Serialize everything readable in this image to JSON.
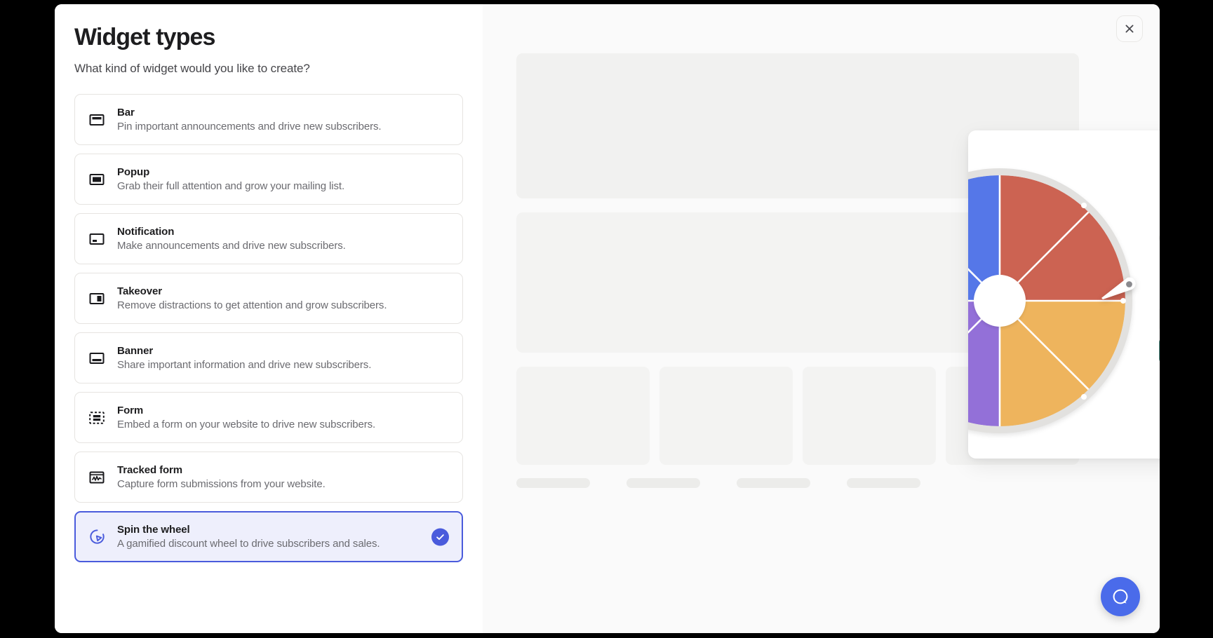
{
  "dialog": {
    "title": "Widget types",
    "subtitle": "What kind of widget would you like to create?",
    "close_label": "×",
    "close_icon": "close-icon"
  },
  "widget_types": [
    {
      "name": "Bar",
      "description": "Pin important announcements and drive new subscribers.",
      "icon": "bar-widget-icon",
      "selected": false
    },
    {
      "name": "Popup",
      "description": "Grab their full attention and grow your mailing list.",
      "icon": "popup-widget-icon",
      "selected": false
    },
    {
      "name": "Notification",
      "description": "Make announcements and drive new subscribers.",
      "icon": "notification-widget-icon",
      "selected": false
    },
    {
      "name": "Takeover",
      "description": "Remove distractions to get attention and grow subscribers.",
      "icon": "takeover-widget-icon",
      "selected": false
    },
    {
      "name": "Banner",
      "description": "Share important information and drive new subscribers.",
      "icon": "banner-widget-icon",
      "selected": false
    },
    {
      "name": "Form",
      "description": "Embed a form on your website to drive new subscribers.",
      "icon": "form-widget-icon",
      "selected": false
    },
    {
      "name": "Tracked form",
      "description": "Capture form submissions from your website.",
      "icon": "tracked-form-widget-icon",
      "selected": false
    },
    {
      "name": "Spin the wheel",
      "description": "A gamified discount wheel to drive subscribers and sales.",
      "icon": "spin-the-wheel-icon",
      "selected": true
    }
  ],
  "preview": {
    "wheel_segment_colors": [
      "#5577e8",
      "#cc6352",
      "#eeb45d",
      "#9370d8"
    ],
    "wheel_rim_color": "#e2e1df",
    "cta_color": "#5a988d",
    "skeleton_color": "#f1f1f0"
  },
  "chat": {
    "icon": "chat-bubble-icon",
    "accent_color": "#4a6bea"
  },
  "accent": {
    "selected_border": "#4a5bdc",
    "selected_background": "#eeeffc"
  }
}
